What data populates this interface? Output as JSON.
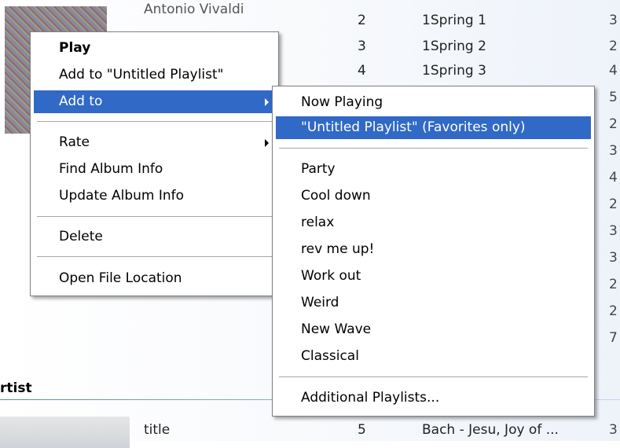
{
  "library": {
    "artist_top": "Antonio Vivaldi",
    "section_header": "rtist",
    "bottom_row": {
      "artist": "title",
      "num": "5",
      "title": "Bach - Jesu, Joy of ...",
      "rating": "3"
    },
    "tracks": [
      {
        "num": "2",
        "title": "1Spring 1",
        "rating": "3"
      },
      {
        "num": "3",
        "title": "1Spring 2",
        "rating": "2"
      },
      {
        "num": "4",
        "title": "1Spring 3",
        "rating": "4"
      }
    ],
    "rating_column": [
      "5",
      "2",
      "3",
      "4",
      "2",
      "3",
      "3",
      "2",
      "2",
      "7"
    ]
  },
  "context_menu": {
    "items": [
      {
        "label": "Play",
        "bold": true
      },
      {
        "label": "Add to \"Untitled Playlist\""
      },
      {
        "label": "Add to",
        "submenu": true,
        "highlighted": true
      },
      {
        "label": "Rate",
        "submenu": true
      },
      {
        "label": "Find Album Info"
      },
      {
        "label": "Update Album Info"
      },
      {
        "label": "Delete"
      },
      {
        "label": "Open File Location"
      }
    ]
  },
  "add_to_submenu": {
    "items": [
      {
        "label": "Now Playing"
      },
      {
        "label": "\"Untitled Playlist\" (Favorites only)",
        "highlighted": true
      },
      {
        "label": "Party"
      },
      {
        "label": "Cool down"
      },
      {
        "label": "relax"
      },
      {
        "label": "rev me up!"
      },
      {
        "label": "Work out"
      },
      {
        "label": "Weird"
      },
      {
        "label": "New Wave"
      },
      {
        "label": "Classical"
      },
      {
        "label": "Additional Playlists..."
      }
    ]
  },
  "colors": {
    "highlight": "#3169c6",
    "highlight_text": "#ffffff",
    "menu_border": "#7f7f7f",
    "section_rule": "#5b87c9"
  }
}
